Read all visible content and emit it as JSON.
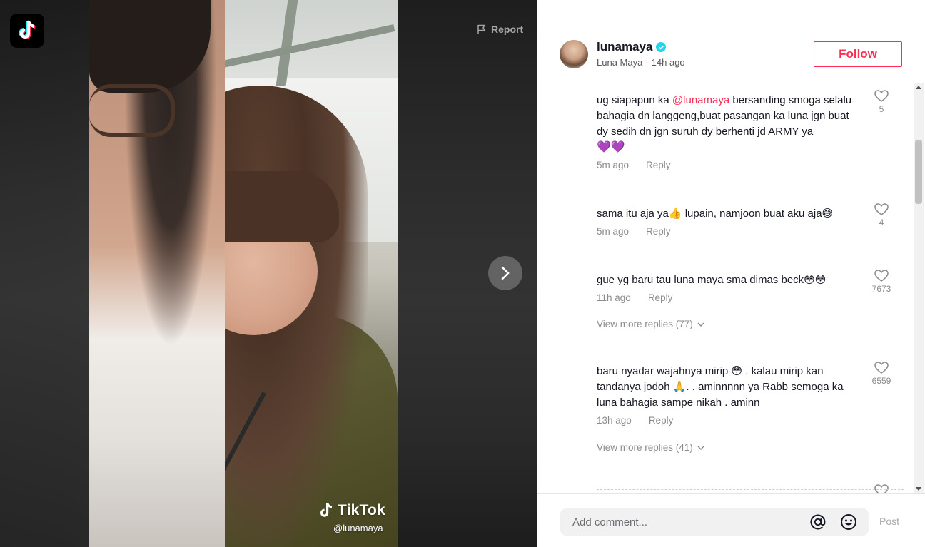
{
  "brand": {
    "logo_icon": "tiktok-logo-icon",
    "accent": "#fe2c55"
  },
  "video": {
    "report_label": "Report",
    "watermark_brand": "TikTok",
    "watermark_user": "@lunamaya"
  },
  "author": {
    "username": "lunamaya",
    "display_name": "Luna Maya",
    "separator": "·",
    "posted": "14h ago",
    "verified": true,
    "follow_label": "Follow"
  },
  "comments": [
    {
      "text_before": "ug siapapun ka ",
      "mention": "@lunamaya",
      "text_after": " bersanding smoga selalu bahagia dn langgeng,buat pasangan ka luna jgn buat dy sedih dn jgn suruh dy berhenti jd ARMY ya",
      "emoji": "💜💜",
      "time": "5m ago",
      "reply": "Reply",
      "likes": "5"
    },
    {
      "text": "sama itu aja ya👍 lupain, namjoon buat aku aja😅",
      "time": "5m ago",
      "reply": "Reply",
      "likes": "4"
    },
    {
      "text": "gue yg baru tau luna maya sma dimas beck😳😳",
      "time": "11h ago",
      "reply": "Reply",
      "likes": "7673",
      "view_more": "View more replies (77)"
    },
    {
      "text": "baru nyadar wajahnya mirip 😳 . kalau mirip kan tandanya jodoh 🙏. . aminnnnn ya Rabb semoga ka luna bahagia sampe nikah . aminn",
      "time": "13h ago",
      "reply": "Reply",
      "likes": "6559",
      "view_more": "View more replies (41)"
    }
  ],
  "composer": {
    "placeholder": "Add comment...",
    "post_label": "Post",
    "mention_icon": "at-sign-icon",
    "emoji_icon": "emoji-icon"
  }
}
